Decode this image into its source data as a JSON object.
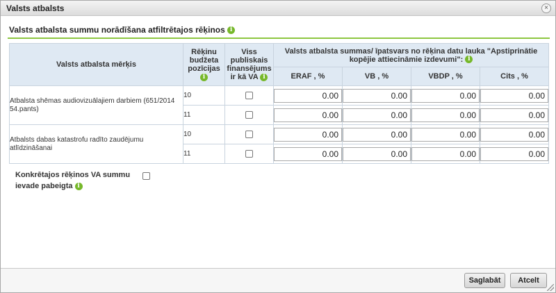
{
  "dialog": {
    "title": "Valsts atbalsts",
    "close_glyph": "×"
  },
  "section": {
    "title": "Valsts atbalsta summu norādīšana atfiltrētajos rēķinos",
    "info_glyph": "i"
  },
  "table": {
    "headers": {
      "purpose": "Valsts atbalsta mērķis",
      "budget_position": "Rēķinu budžeta pozīcijas",
      "public_funding": "Viss publiskais finansējums ir kā VA",
      "amounts_group": "Valsts atbalsta summas/ īpatsvars no rēķina datu lauka \"Apstiprinātie kopējie attiecināmie izdevumi\":",
      "eraf": "ERAF , %",
      "vb": "VB , %",
      "vbdp": "VBDP , %",
      "cits": "Cits , %"
    },
    "groups": [
      {
        "purpose": "Atbalsta shēmas audiovizuālajiem darbiem (651/2014 54.pants)",
        "rows": [
          {
            "code": "10",
            "public_all_va": false,
            "eraf": "0.00",
            "vb": "0.00",
            "vbdp": "0.00",
            "cits": "0.00"
          },
          {
            "code": "11",
            "public_all_va": false,
            "eraf": "0.00",
            "vb": "0.00",
            "vbdp": "0.00",
            "cits": "0.00"
          }
        ]
      },
      {
        "purpose": "Atbalsts dabas katastrofu radīto zaudējumu atlīdzināšanai",
        "rows": [
          {
            "code": "10",
            "public_all_va": false,
            "eraf": "0.00",
            "vb": "0.00",
            "vbdp": "0.00",
            "cits": "0.00"
          },
          {
            "code": "11",
            "public_all_va": false,
            "eraf": "0.00",
            "vb": "0.00",
            "vbdp": "0.00",
            "cits": "0.00"
          }
        ]
      }
    ]
  },
  "completion": {
    "label": "Konkrētajos rēķinos VA summu ievade pabeigta",
    "checked": false
  },
  "footer": {
    "save_label": "Saglabāt",
    "cancel_label": "Atcelt"
  },
  "colors": {
    "accent_green": "#8cc63f",
    "header_bg": "#dfe9f3",
    "info_icon": "#76b82a"
  },
  "icons": {
    "info": "info-icon",
    "close": "close-icon",
    "resize": "resize-grip-icon"
  }
}
